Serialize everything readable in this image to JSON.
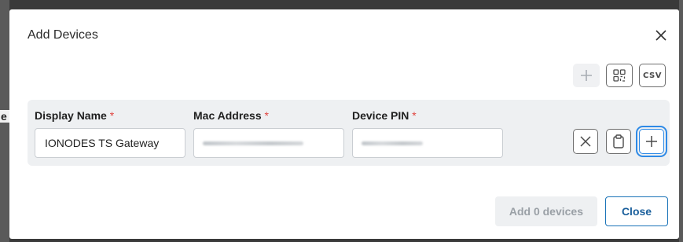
{
  "dialog": {
    "title": "Add Devices"
  },
  "toolbar": {
    "csv_label": "CSV"
  },
  "fields": [
    {
      "label": "Display Name",
      "required_mark": "*",
      "value": "IONODES TS Gateway"
    },
    {
      "label": "Mac Address",
      "required_mark": "*",
      "value": ""
    },
    {
      "label": "Device PIN",
      "required_mark": "*",
      "value": ""
    }
  ],
  "footer": {
    "add_label": "Add 0 devices",
    "close_label": "Close"
  },
  "colors": {
    "accent": "#1a73b8",
    "focus": "#2e8ae6",
    "required": "#e0433e"
  }
}
